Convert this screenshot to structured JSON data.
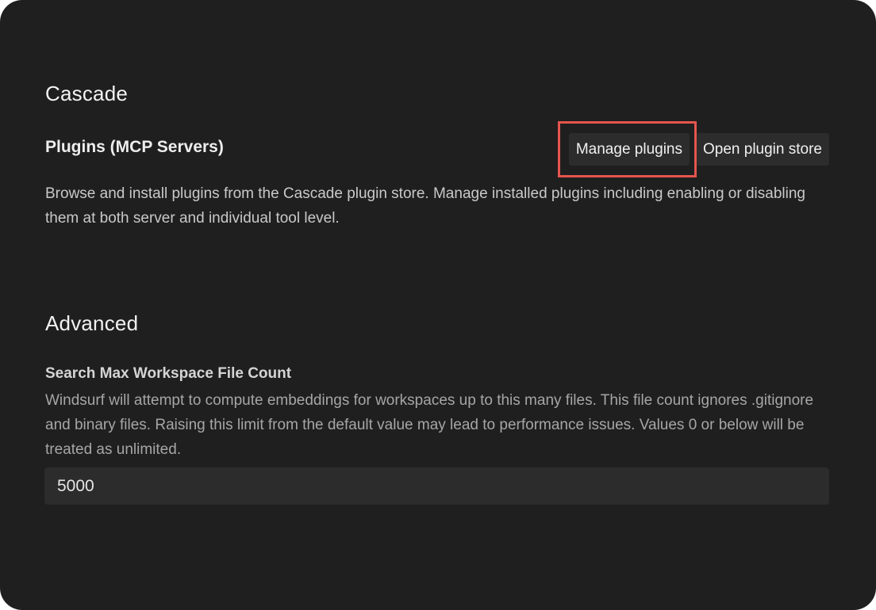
{
  "cascade": {
    "title": "Cascade",
    "plugins": {
      "title": "Plugins (MCP Servers)",
      "manage_label": "Manage plugins",
      "store_label": "Open plugin store",
      "description": "Browse and install plugins from the Cascade plugin store. Manage installed plugins including enabling or disabling them at both server and individual tool level."
    }
  },
  "advanced": {
    "title": "Advanced",
    "search_max_file_count": {
      "title": "Search Max Workspace File Count",
      "description": "Windsurf will attempt to compute embeddings for workspaces up to this many files. This file count ignores .gitignore and binary files. Raising this limit from the default value may lead to performance issues. Values 0 or below will be treated as unlimited.",
      "value": "5000"
    }
  },
  "colors": {
    "background": "#1f1f1f",
    "button_bg": "#2c2c2c",
    "highlight": "#e5554e"
  }
}
